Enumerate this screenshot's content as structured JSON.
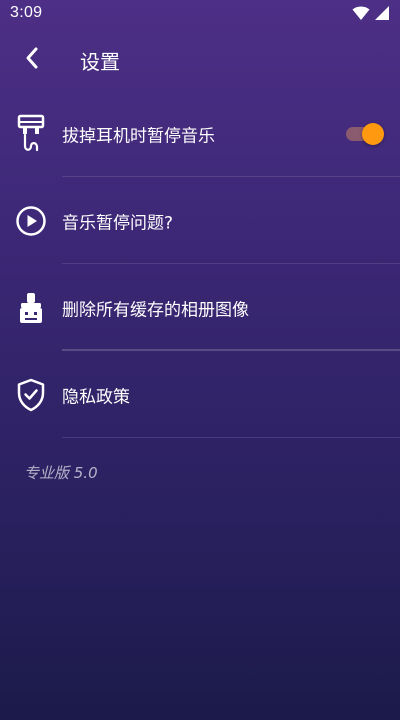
{
  "status": {
    "time": "3:09",
    "icons": [
      "wifi-icon",
      "cellular-signal-icon"
    ]
  },
  "appbar": {
    "title": "设置",
    "back_icon": "chevron-left-icon"
  },
  "settings": [
    {
      "icon": "headphone-unplug-icon",
      "label": "拔掉耳机时暂停音乐",
      "toggle": true,
      "enabled": true
    },
    {
      "icon": "play-circle-icon",
      "label": "音乐暂停问题?"
    },
    {
      "icon": "cleaning-brush-icon",
      "label": "删除所有缓存的相册图像"
    },
    {
      "icon": "shield-check-icon",
      "label": "隐私政策"
    }
  ],
  "version": "专业版 5.0",
  "colors": {
    "accent": "#ff9a10",
    "track": "#8a5a6e",
    "background_top": "#4d2f86",
    "background_bottom": "#1c1a4a"
  }
}
